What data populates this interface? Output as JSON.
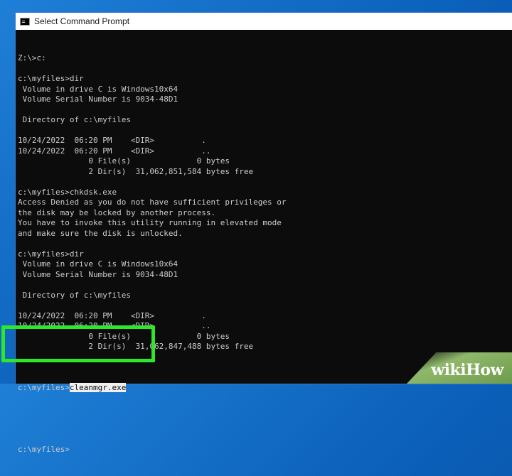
{
  "window": {
    "title": "Select Command Prompt"
  },
  "console_lines": [
    "Z:\\>c:",
    "",
    "c:\\myfiles>dir",
    " Volume in drive C is Windows10x64",
    " Volume Serial Number is 9034-48D1",
    "",
    " Directory of c:\\myfiles",
    "",
    "10/24/2022  06:20 PM    <DIR>          .",
    "10/24/2022  06:20 PM    <DIR>          ..",
    "               0 File(s)              0 bytes",
    "               2 Dir(s)  31,062,851,584 bytes free",
    "",
    "c:\\myfiles>chkdsk.exe",
    "Access Denied as you do not have sufficient privileges or",
    "the disk may be locked by another process.",
    "You have to invoke this utility running in elevated mode",
    "and make sure the disk is unlocked.",
    "",
    "c:\\myfiles>dir",
    " Volume in drive C is Windows10x64",
    " Volume Serial Number is 9034-48D1",
    "",
    " Directory of c:\\myfiles",
    "",
    "10/24/2022  06:20 PM    <DIR>          .",
    "10/24/2022  06:20 PM    <DIR>          ..",
    "               0 File(s)              0 bytes",
    "               2 Dir(s)  31,062,847,488 bytes free",
    ""
  ],
  "current_command": {
    "prompt": "c:\\myfiles>",
    "input": "cleanmgr.exe"
  },
  "next_prompt": "c:\\myfiles>",
  "highlight_color": "#2ee62a",
  "brand": "wikiHow"
}
